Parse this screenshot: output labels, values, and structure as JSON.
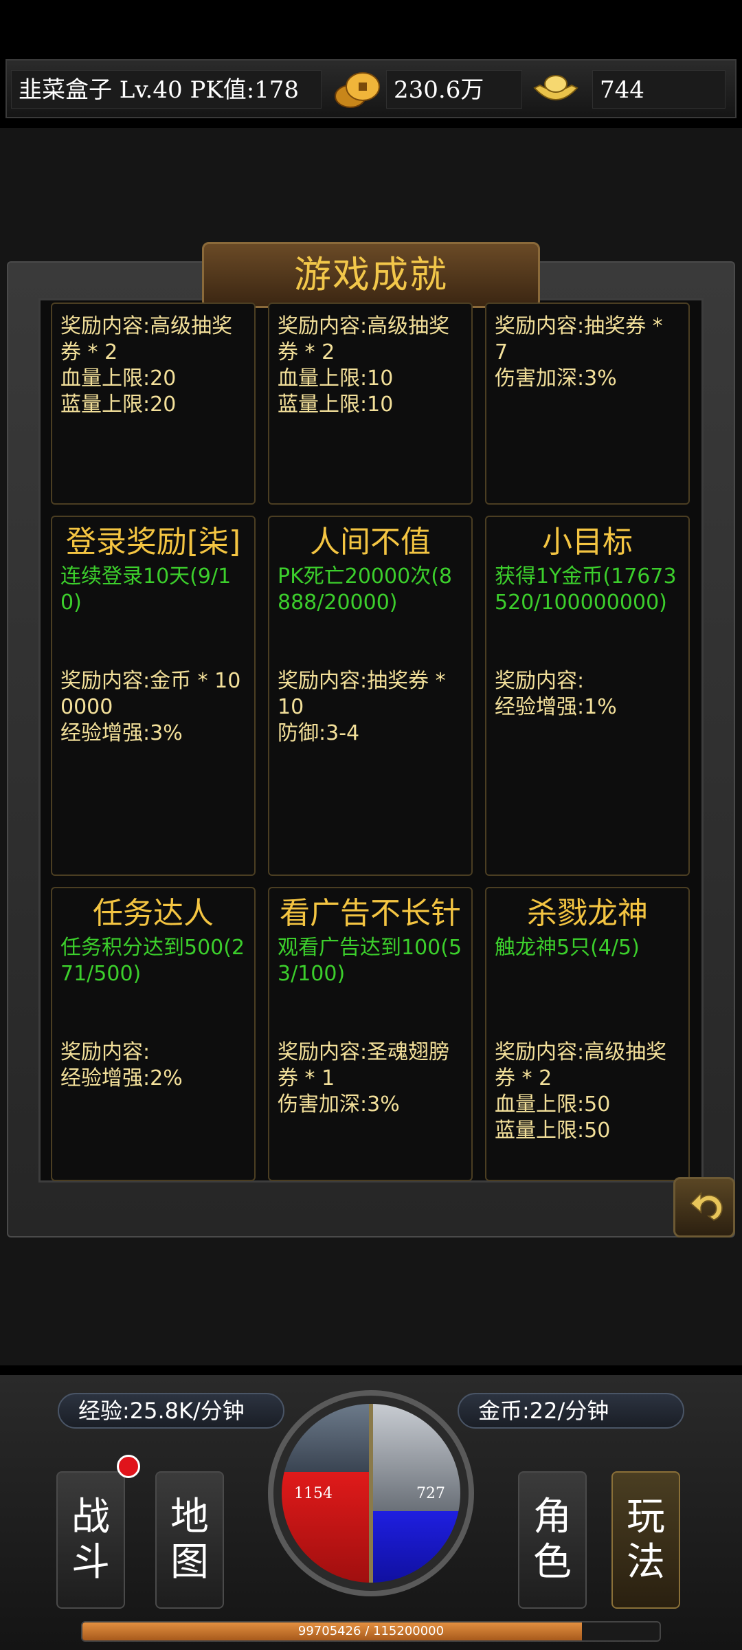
{
  "header": {
    "player": "韭菜盒子  Lv.40 PK值:178",
    "gold": "230.6万",
    "ingot": "744"
  },
  "panel": {
    "title": "游戏成就"
  },
  "achievements": [
    {
      "title": "",
      "cond": "",
      "reward": "奖励内容:高级抽奖券 * 2",
      "line2": "血量上限:20",
      "line3": "蓝量上限:20"
    },
    {
      "title": "",
      "cond": "",
      "reward": "奖励内容:高级抽奖券 * 2",
      "line2": "血量上限:10",
      "line3": "蓝量上限:10"
    },
    {
      "title": "",
      "cond": "",
      "reward": "奖励内容:抽奖券 * 7",
      "line2": "伤害加深:3%",
      "line3": ""
    },
    {
      "title": "登录奖励[柒]",
      "cond": "连续登录10天(9/10)",
      "reward": "奖励内容:金币 * 100000",
      "line2": "经验增强:3%",
      "line3": ""
    },
    {
      "title": "人间不值",
      "cond": "PK死亡20000次(8888/20000)",
      "reward": "奖励内容:抽奖券 * 10",
      "line2": "防御:3-4",
      "line3": ""
    },
    {
      "title": "小目标",
      "cond": "获得1Y金币(17673520/100000000)",
      "reward": "奖励内容:",
      "line2": "经验增强:1%",
      "line3": ""
    },
    {
      "title": "任务达人",
      "cond": "任务积分达到500(271/500)",
      "reward": "奖励内容:",
      "line2": "经验增强:2%",
      "line3": ""
    },
    {
      "title": "看广告不长针",
      "cond": "观看广告达到100(53/100)",
      "reward": "奖励内容:圣魂翅膀券 * 1",
      "line2": "伤害加深:3%",
      "line3": ""
    },
    {
      "title": "杀戮龙神",
      "cond": "触龙神5只(4/5)",
      "reward": "奖励内容:高级抽奖券 * 2",
      "line2": "血量上限:50",
      "line3": "蓝量上限:50"
    }
  ],
  "hud": {
    "exp_rate": "经验:25.8K/分钟",
    "gold_rate": "金币:22/分钟",
    "hp": "1154",
    "mp": "727",
    "exp_text": "99705426 / 115200000",
    "exp_fraction": 0.8655,
    "buttons": {
      "battle": "战斗",
      "map": "地图",
      "role": "角色",
      "play": "玩法"
    }
  },
  "colors": {
    "accent_gold": "#f4c542",
    "condition_green": "#3ccf2c",
    "hp_red": "#e01a1a",
    "mp_blue": "#1f1fe0"
  }
}
